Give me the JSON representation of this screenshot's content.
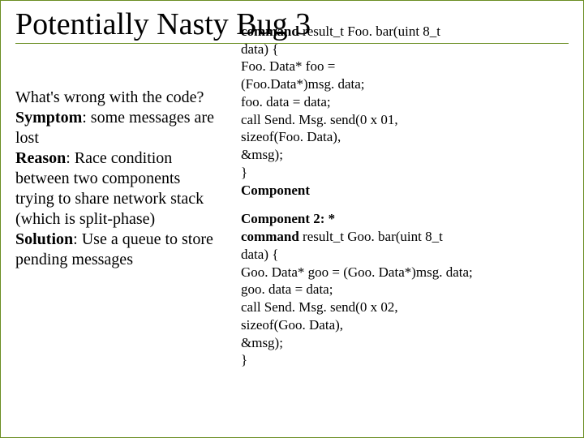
{
  "title": "Potentially Nasty Bug 3",
  "left": {
    "p1": "What's wrong with the code?",
    "symptom_label": "Symptom",
    "symptom_text": ": some messages are lost",
    "reason_label": "Reason",
    "reason_text": ": Race condition between two components trying to share network stack (which is split-phase)",
    "solution_label": " Solution",
    "solution_text": ": Use a queue to store pending messages"
  },
  "code1": {
    "l1a": "command",
    "l1b": " result_t Foo. bar(uint 8_t",
    "l2": "data) {",
    "l3": "Foo. Data* foo =",
    "l4": "(Foo.Data*)msg. data;",
    "l5": "foo. data = data;",
    "l6": "call Send. Msg. send(0 x 01,",
    "l7": "sizeof(Foo. Data),",
    "l8": "&msg);",
    "l9": "}",
    "l10": "Component"
  },
  "code2": {
    "l0": "Component 2: *",
    "l1a": "command",
    "l1b": " result_t Goo. bar(uint 8_t",
    "l2": "data) {",
    "l3": "Goo. Data* goo = (Goo. Data*)msg. data;",
    "l4": "goo. data = data;",
    "l5": "call Send. Msg. send(0 x 02,",
    "l6": "sizeof(Goo. Data),",
    "l7": "&msg);",
    "l8": "}"
  }
}
